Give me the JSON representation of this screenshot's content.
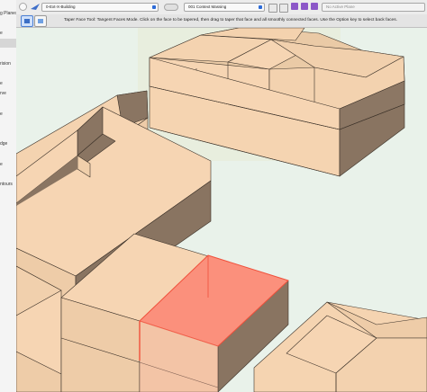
{
  "toolbar": {
    "class_value": "0-Ext-X-Building",
    "layer_value": "001 Context Massing",
    "plane_value": "No Active Plane"
  },
  "modebar": {
    "hint": "Taper Face Tool: Tangent Faces Mode. Click on the face to be tapered, then drag to taper that face and all smoothly connected faces.  Use the Option key to select back faces."
  },
  "sidebar": {
    "items": [
      {
        "label": "g Planes"
      },
      {
        "label": "e"
      },
      {
        "label": "rision"
      },
      {
        "label": "e"
      },
      {
        "label": "rve"
      },
      {
        "label": "e"
      },
      {
        "label": "dge"
      },
      {
        "label": "e"
      },
      {
        "label": "ntours"
      }
    ]
  },
  "colors": {
    "top_face": "#f6d5b3",
    "side_light": "#eecca8",
    "side_dark": "#897461",
    "selected_face": "#fb907c",
    "selected_edge": "#f0513c",
    "edge": "#3c3229",
    "viewport_bg": "#e9f2ea"
  }
}
